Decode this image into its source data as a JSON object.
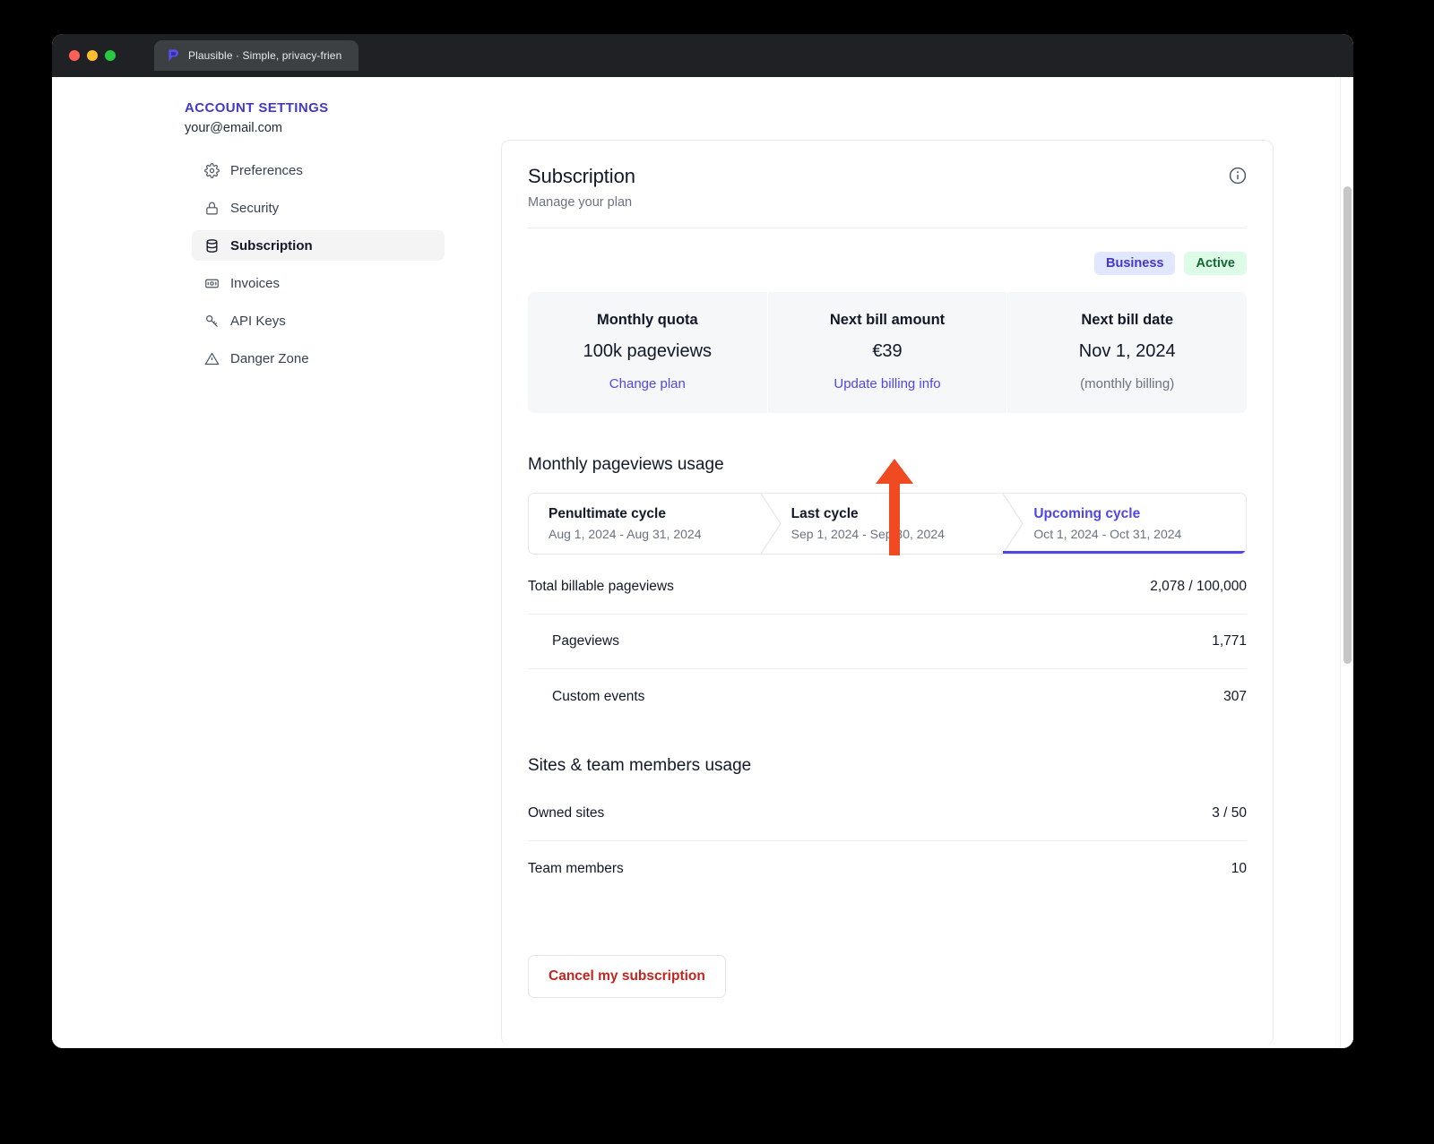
{
  "browser": {
    "tab_title": "Plausible · Simple, privacy-frien",
    "favicon": "plausible-logo-icon",
    "traffic_lights": [
      "close-button",
      "minimize-button",
      "maximize-button"
    ]
  },
  "sidebar": {
    "heading": "ACCOUNT SETTINGS",
    "email": "your@email.com",
    "items": [
      {
        "label": "Preferences",
        "icon": "gear-icon",
        "active": false
      },
      {
        "label": "Security",
        "icon": "lock-icon",
        "active": false
      },
      {
        "label": "Subscription",
        "icon": "database-icon",
        "active": true
      },
      {
        "label": "Invoices",
        "icon": "banknote-icon",
        "active": false
      },
      {
        "label": "API Keys",
        "icon": "key-icon",
        "active": false
      },
      {
        "label": "Danger Zone",
        "icon": "warning-triangle-icon",
        "active": false
      }
    ]
  },
  "card": {
    "title": "Subscription",
    "subtitle": "Manage your plan",
    "info_icon": "info-circle-icon",
    "badges": {
      "plan": "Business",
      "status": "Active"
    },
    "stats": [
      {
        "label": "Monthly quota",
        "value": "100k pageviews",
        "action": "Change plan",
        "note": ""
      },
      {
        "label": "Next bill amount",
        "value": "€39",
        "action": "Update billing info",
        "note": ""
      },
      {
        "label": "Next bill date",
        "value": "Nov 1, 2024",
        "action": "",
        "note": "(monthly billing)"
      }
    ],
    "pageviews_section": {
      "title": "Monthly pageviews usage",
      "cycles": [
        {
          "name": "Penultimate cycle",
          "range": "Aug 1, 2024 - Aug 31, 2024",
          "active": false
        },
        {
          "name": "Last cycle",
          "range": "Sep 1, 2024 - Sep 30, 2024",
          "active": false
        },
        {
          "name": "Upcoming cycle",
          "range": "Oct 1, 2024 - Oct 31, 2024",
          "active": true
        }
      ],
      "rows": [
        {
          "label": "Total billable pageviews",
          "value": "2,078 / 100,000",
          "indent": false
        },
        {
          "label": "Pageviews",
          "value": "1,771",
          "indent": true
        },
        {
          "label": "Custom events",
          "value": "307",
          "indent": true
        }
      ]
    },
    "sites_section": {
      "title": "Sites & team members usage",
      "rows": [
        {
          "label": "Owned sites",
          "value": "3 / 50",
          "indent": false
        },
        {
          "label": "Team members",
          "value": "10",
          "indent": false
        }
      ]
    },
    "cancel_label": "Cancel my subscription"
  },
  "annotation": {
    "name": "red-arrow-pointing-to-update-billing-info",
    "color": "#f04a22",
    "points_at": "Update billing info"
  },
  "colors": {
    "accent_indigo": "#4f46e5",
    "badge_plan_bg": "#e0e7ff",
    "badge_plan_text": "#4338ca",
    "badge_status_bg": "#dcfce7",
    "badge_status_text": "#166534",
    "danger_red": "#c0261f",
    "annotation_orange": "#f04a22"
  },
  "scrollbar": {
    "name": "vertical-scrollbar"
  }
}
